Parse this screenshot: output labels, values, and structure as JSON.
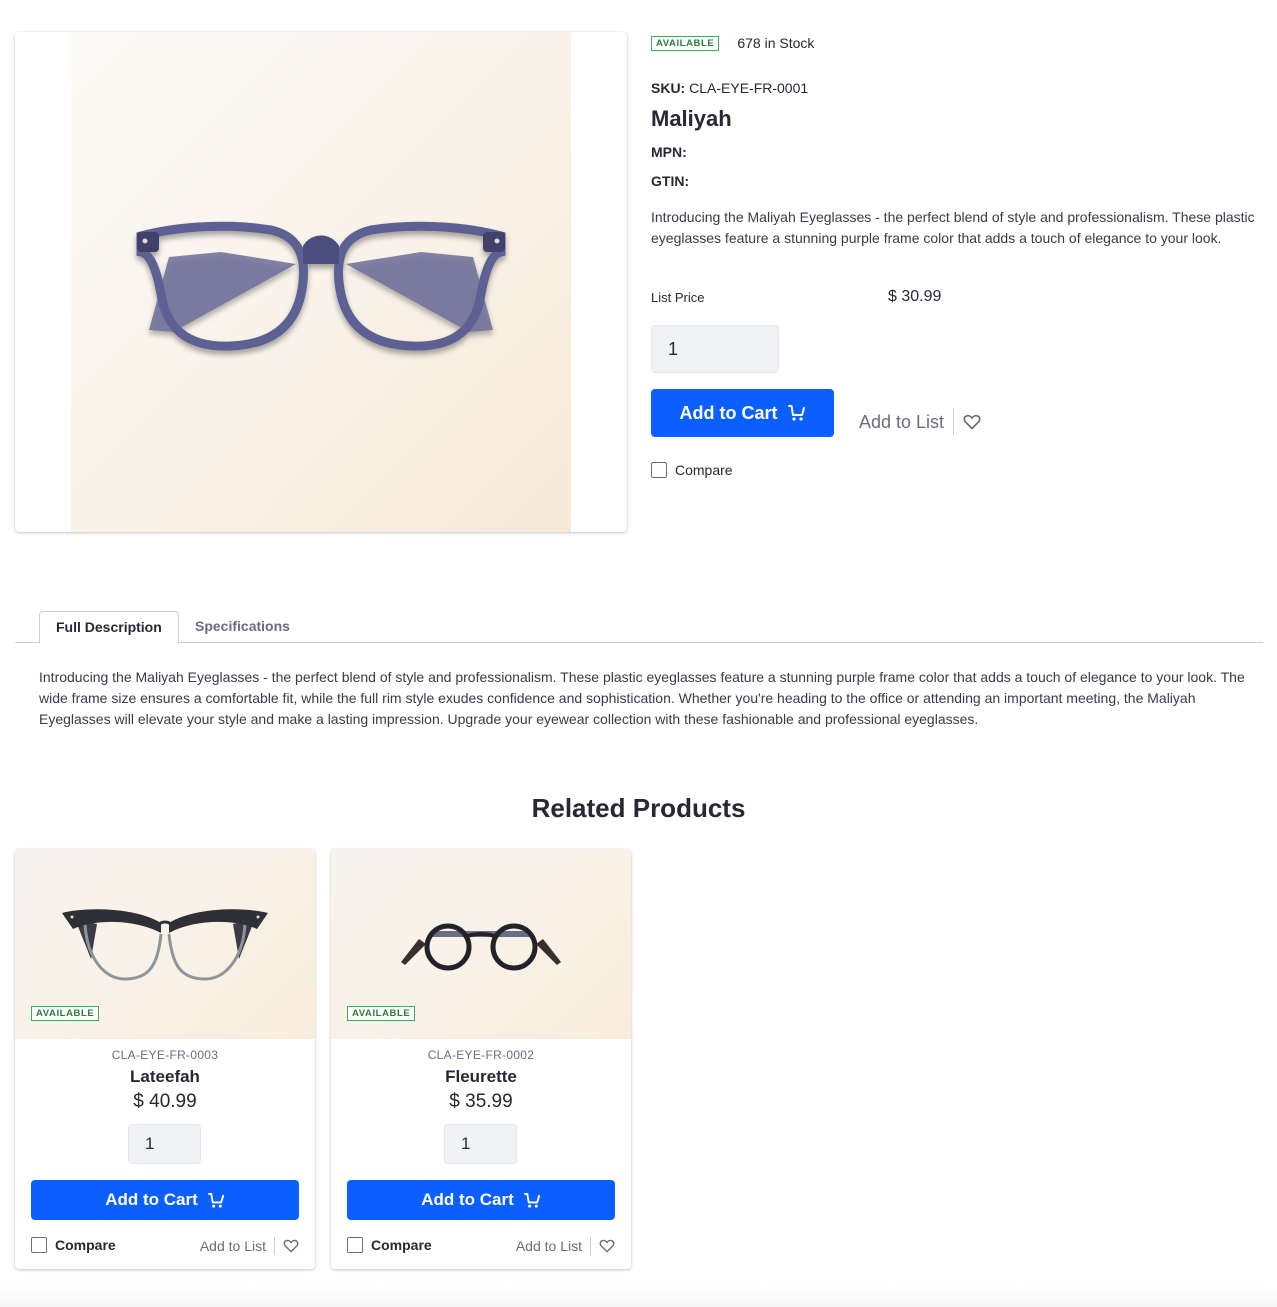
{
  "product": {
    "availability": "AVAILABLE",
    "stock": "678 in Stock",
    "sku_label": "SKU:",
    "sku": "CLA-EYE-FR-0001",
    "name": "Maliyah",
    "mpn_label": "MPN:",
    "mpn": "",
    "gtin_label": "GTIN:",
    "gtin": "",
    "short_description": "Introducing the Maliyah Eyeglasses - the perfect blend of style and professionalism. These plastic eyeglasses feature a stunning purple frame color that adds a touch of elegance to your look.",
    "list_price_label": "List Price",
    "list_price": "$ 30.99",
    "quantity": "1",
    "add_to_cart": "Add to Cart",
    "add_to_list": "Add to List",
    "compare": "Compare",
    "image_alt": "purple-frame-eyeglasses"
  },
  "tabs": [
    {
      "label": "Full Description",
      "active": true
    },
    {
      "label": "Specifications",
      "active": false
    }
  ],
  "full_description": "Introducing the Maliyah Eyeglasses - the perfect blend of style and professionalism. These plastic eyeglasses feature a stunning purple frame color that adds a touch of elegance to your look. The wide frame size ensures a comfortable fit, while the full rim style exudes confidence and sophistication. Whether you're heading to the office or attending an important meeting, the Maliyah Eyeglasses will elevate your style and make a lasting impression. Upgrade your eyewear collection with these fashionable and professional eyeglasses.",
  "related": {
    "title": "Related Products",
    "items": [
      {
        "availability": "AVAILABLE",
        "sku": "CLA-EYE-FR-0003",
        "name": "Lateefah",
        "price": "$ 40.99",
        "quantity": "1",
        "add_to_cart": "Add to Cart",
        "compare": "Compare",
        "add_to_list": "Add to List"
      },
      {
        "availability": "AVAILABLE",
        "sku": "CLA-EYE-FR-0002",
        "name": "Fleurette",
        "price": "$ 35.99",
        "quantity": "1",
        "add_to_cart": "Add to Cart",
        "compare": "Compare",
        "add_to_list": "Add to List"
      }
    ]
  },
  "colors": {
    "primary": "#0b5fff",
    "available_border": "#3ab05a",
    "available_text": "#287d3c",
    "text": "#272833",
    "muted": "#6b6c7e"
  },
  "icons": {
    "cart": "cart-icon",
    "heart": "heart-icon"
  }
}
